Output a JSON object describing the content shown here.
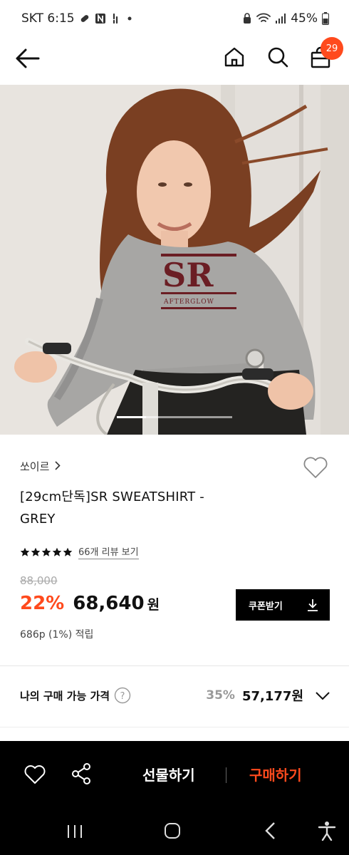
{
  "status_bar": {
    "carrier_time": "SKT 6:15",
    "battery": "45%",
    "notification_icons": [
      "pill-icon",
      "n-icon",
      "walk-icon",
      "dot-icon"
    ],
    "right_icons": [
      "lock-icon",
      "wifi-icon",
      "signal-icon",
      "battery-icon"
    ]
  },
  "header": {
    "cart_count": "29",
    "icons": [
      "back-arrow-icon",
      "home-icon",
      "search-icon",
      "shopping-bag-icon"
    ]
  },
  "hero": {
    "logo_text": "SR",
    "logo_subtext": "AFTERGLOW",
    "carousel_progress": 0.25
  },
  "product": {
    "brand": "쏘이르",
    "brand_chevron": "›",
    "title_line1": "[29cm단독]SR SWEATSHIRT -",
    "title_line2": "GREY",
    "rating_stars": 5,
    "review_link": "66개 리뷰 보기",
    "original_price": "88,000",
    "discount": "22%",
    "price": "68,640",
    "won": "원",
    "coupon_label": "쿠폰받기",
    "points": "686p (1%) 적립"
  },
  "my_price": {
    "label": "나의 구매 가능 가격",
    "help": "?",
    "discount": "35%",
    "price": "57,177",
    "won": "원"
  },
  "bottom_bar": {
    "gift_label": "선물하기",
    "buy_label": "구매하기"
  },
  "colors": {
    "accent": "#ff4a1d",
    "bottom_bar": "#000000"
  }
}
